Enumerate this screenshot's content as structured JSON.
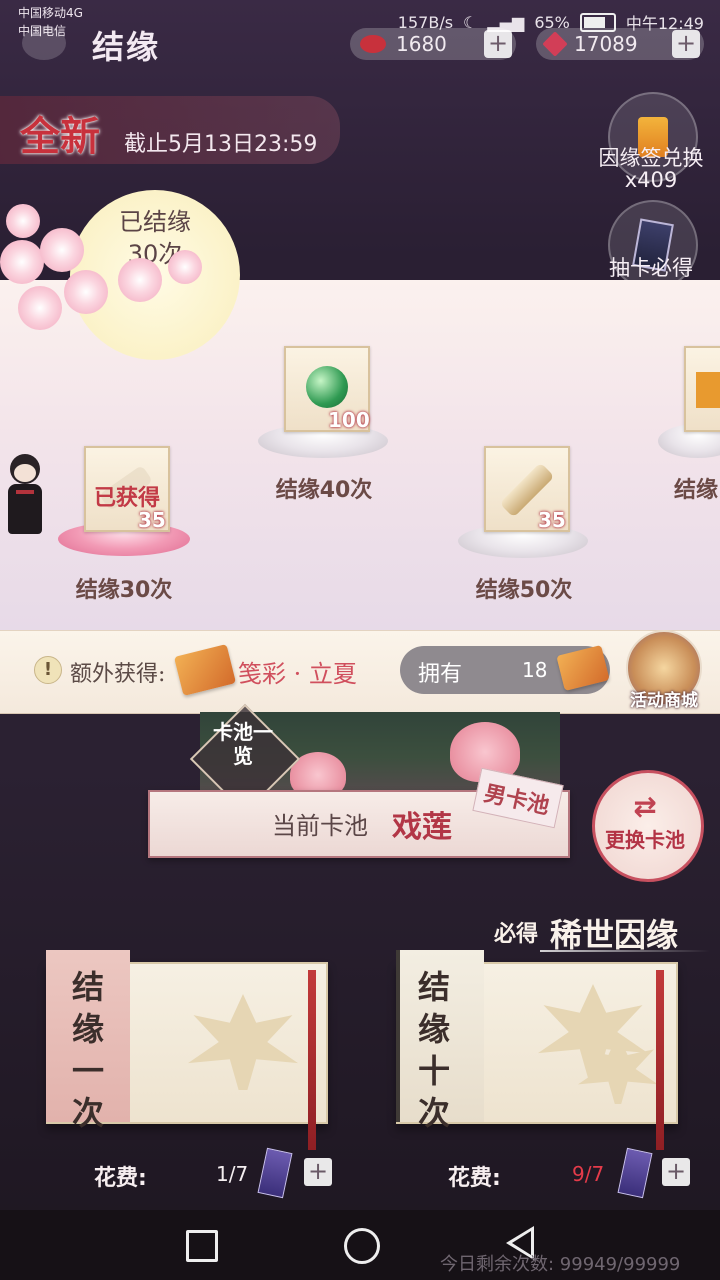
{
  "status_bar": {
    "carrier1": "中国移动4G",
    "carrier2": "中国电信",
    "speed": "157B/s",
    "battery": "65%",
    "time": "中午12:49"
  },
  "header": {
    "title": "结缘",
    "resources": [
      {
        "value": "1680",
        "color": "#c8313c"
      },
      {
        "value": "17089",
        "color": "#d23e57"
      }
    ]
  },
  "event": {
    "badge": "全新",
    "deadline": "截止5月13日23:59"
  },
  "side_buttons": [
    {
      "label": "因缘签兑换",
      "sub": "x409"
    },
    {
      "label": "抽卡必得"
    }
  ],
  "progress": {
    "line1": "已结缘",
    "line2": "30次"
  },
  "milestones": [
    {
      "label": "结缘30次",
      "count": "35",
      "status": "已获得"
    },
    {
      "label": "结缘40次",
      "count": "100"
    },
    {
      "label": "结缘50次",
      "count": "35"
    },
    {
      "label": "结缘"
    }
  ],
  "extra": {
    "label": "额外获得:",
    "item": "笺彩 · 立夏",
    "own_label": "拥有",
    "own_value": "18",
    "shop_label": "活动商城"
  },
  "pool": {
    "list_label": "卡池一览",
    "current_label": "当前卡池",
    "name": "戏莲",
    "tag": "男卡池",
    "switch_label": "更换卡池",
    "guarantee_prefix": "必得",
    "guarantee_text": "稀世因缘"
  },
  "draws": [
    {
      "title": "结缘一次",
      "cost_label": "花费:",
      "cost": "1/7"
    },
    {
      "title": "结缘十次",
      "cost_label": "花费:",
      "cost": "9/7"
    }
  ],
  "footer": {
    "remaining": "今日剩余次数: 99949/99999"
  }
}
